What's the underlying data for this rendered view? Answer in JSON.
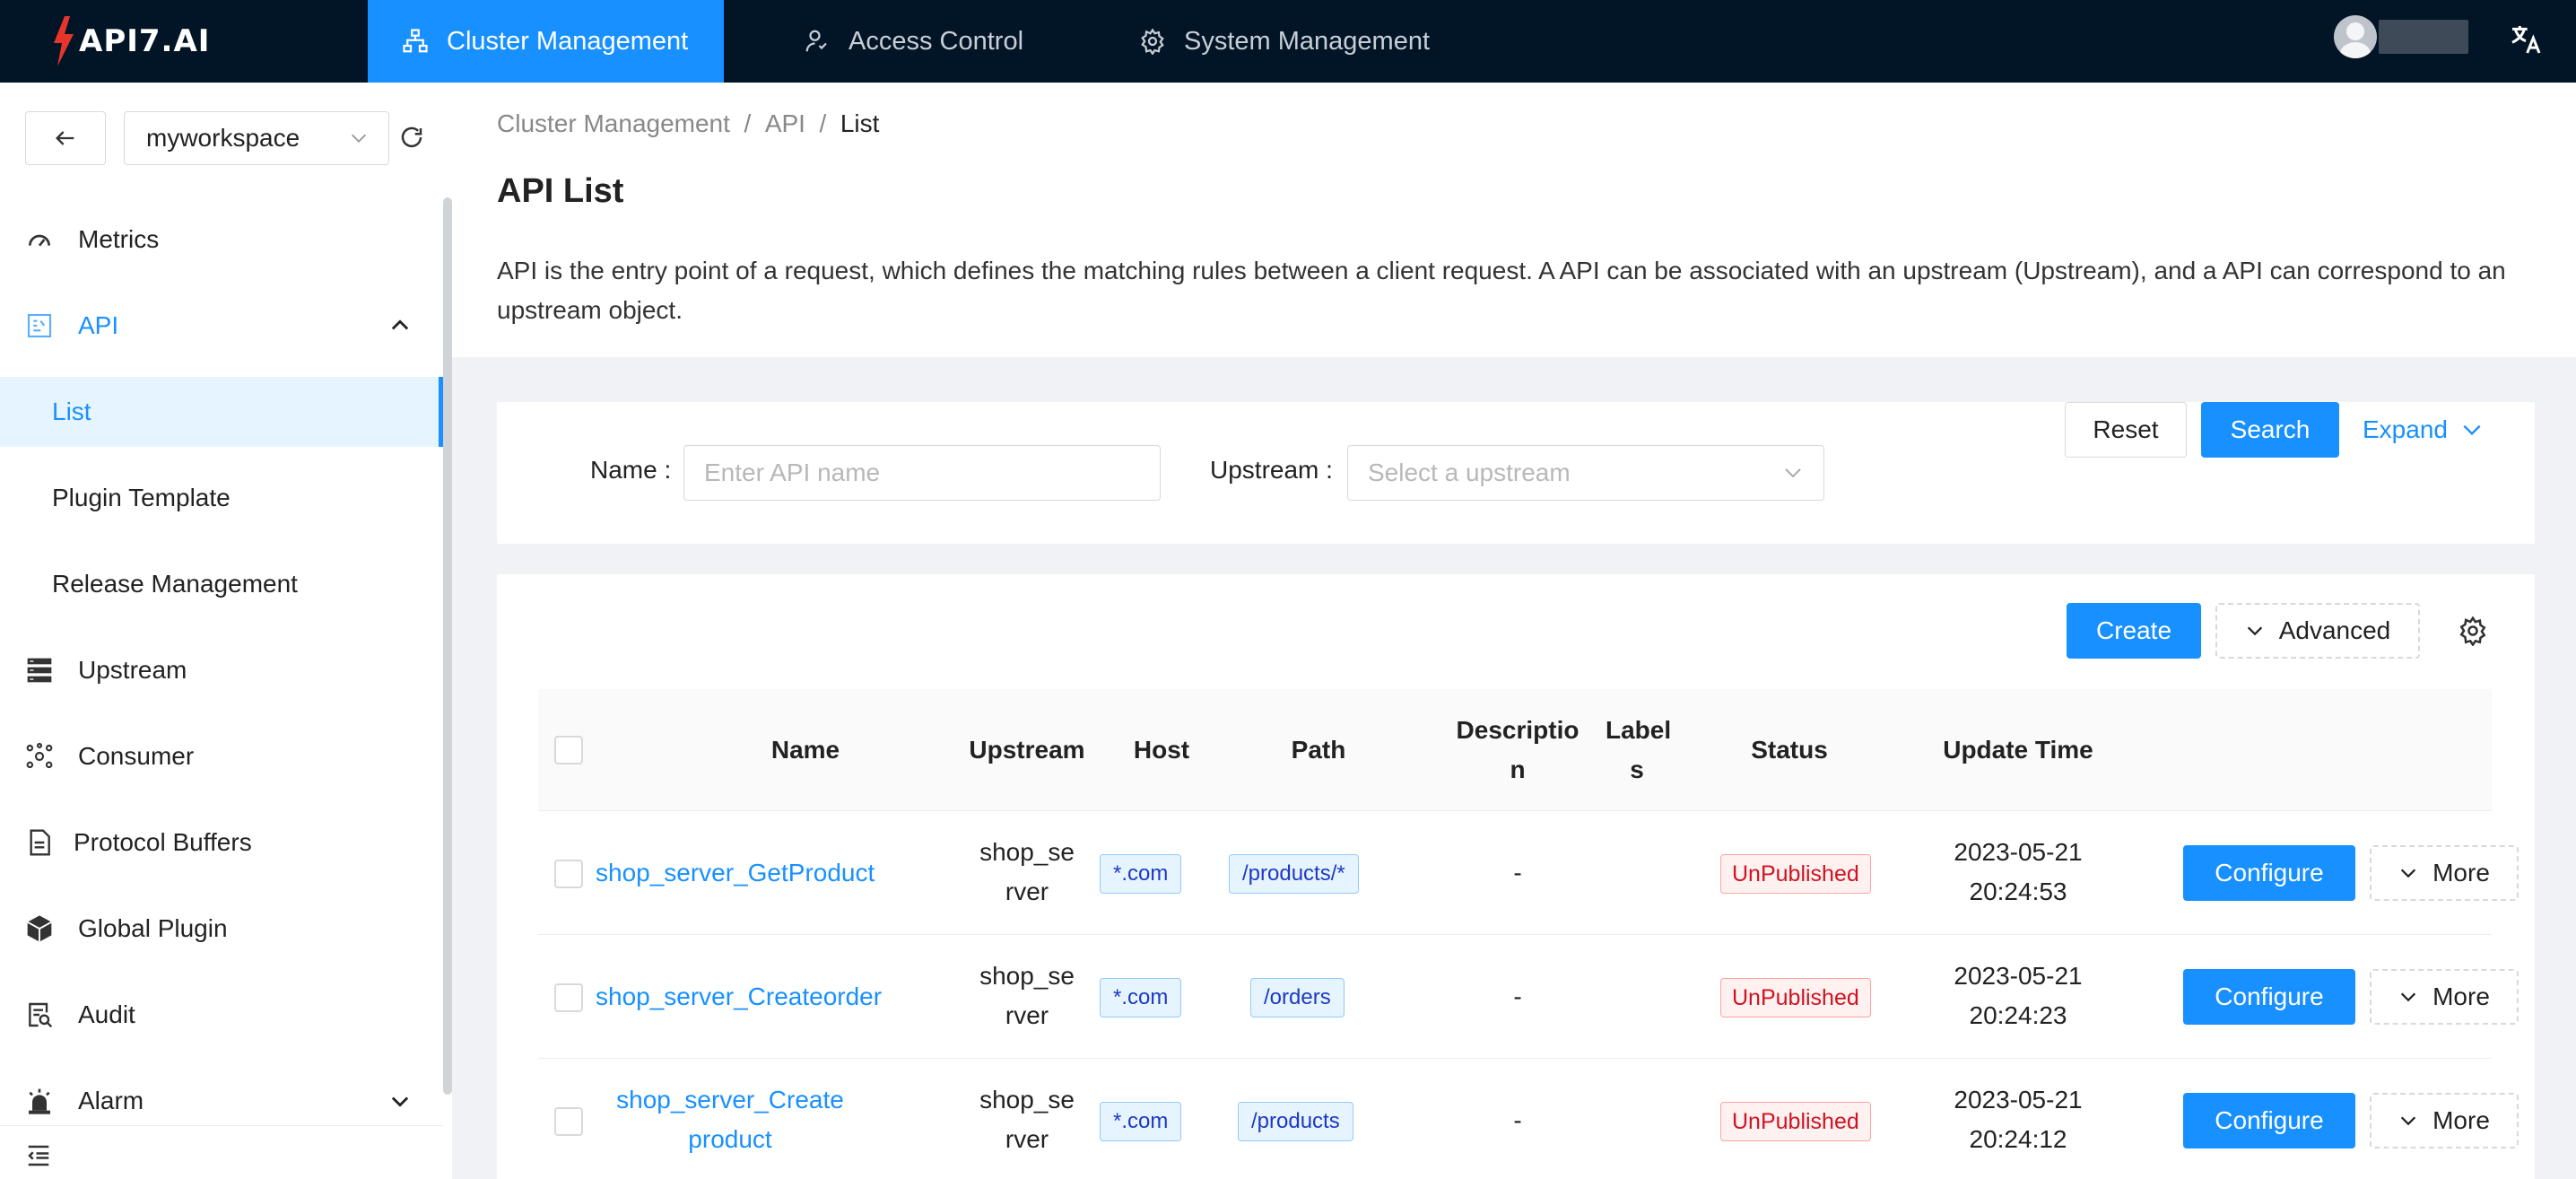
{
  "topbar": {
    "logo_text": "API7.AI",
    "tabs": [
      {
        "label": "Cluster Management",
        "icon": "cluster-icon",
        "active": true
      },
      {
        "label": "Access Control",
        "icon": "access-control-icon",
        "active": false
      },
      {
        "label": "System Management",
        "icon": "gear-icon",
        "active": false
      }
    ],
    "language_icon": "translate-icon",
    "colors": {
      "bar": "#021527",
      "accent": "#1890ff",
      "logo_bolt": "#e8352b"
    }
  },
  "sidebar": {
    "workspace": "myworkspace",
    "menu": [
      {
        "label": "Metrics",
        "icon": "dashboard-icon"
      },
      {
        "label": "API",
        "icon": "api-icon",
        "expanded": true,
        "children": [
          {
            "label": "List",
            "selected": true
          },
          {
            "label": "Plugin Template"
          },
          {
            "label": "Release Management"
          }
        ]
      },
      {
        "label": "Upstream",
        "icon": "server-icon"
      },
      {
        "label": "Consumer",
        "icon": "consumer-icon"
      },
      {
        "label": "Protocol Buffers",
        "icon": "file-icon"
      },
      {
        "label": "Global Plugin",
        "icon": "cube-icon"
      },
      {
        "label": "Audit",
        "icon": "audit-icon"
      },
      {
        "label": "Alarm",
        "icon": "alarm-icon",
        "expanded": false
      }
    ]
  },
  "header": {
    "breadcrumb": [
      "Cluster Management",
      "API",
      "List"
    ],
    "title": "API List",
    "description": "API is the entry point of a request, which defines the matching rules between a client request. A API can be associated with an upstream (Upstream), and a API can correspond to an upstream object."
  },
  "filter": {
    "name_label": "Name",
    "name_placeholder": "Enter API name",
    "upstream_label": "Upstream",
    "upstream_placeholder": "Select a upstream",
    "reset_label": "Reset",
    "search_label": "Search",
    "expand_label": "Expand"
  },
  "toolbar": {
    "create_label": "Create",
    "advanced_label": "Advanced"
  },
  "table": {
    "columns": [
      "Name",
      "Upstream",
      "Host",
      "Path",
      "Descriptio n",
      "Label s",
      "Status",
      "Update Time"
    ],
    "rows": [
      {
        "name": "shop_server_GetProduct",
        "upstream": "shop_server",
        "host": "*.com",
        "path": "/products/*",
        "description": "-",
        "status": "UnPublished",
        "update_date": "2023-05-21",
        "update_time": "20:24:53"
      },
      {
        "name": "shop_server_Createorder",
        "upstream": "shop_server",
        "host": "*.com",
        "path": "/orders",
        "description": "-",
        "status": "UnPublished",
        "update_date": "2023-05-21",
        "update_time": "20:24:23"
      },
      {
        "name": "shop_server_Createproduct",
        "upstream": "shop_server",
        "host": "*.com",
        "path": "/products",
        "description": "-",
        "status": "UnPublished",
        "update_date": "2023-05-21",
        "update_time": "20:24:12"
      }
    ],
    "configure_label": "Configure",
    "more_label": "More"
  }
}
